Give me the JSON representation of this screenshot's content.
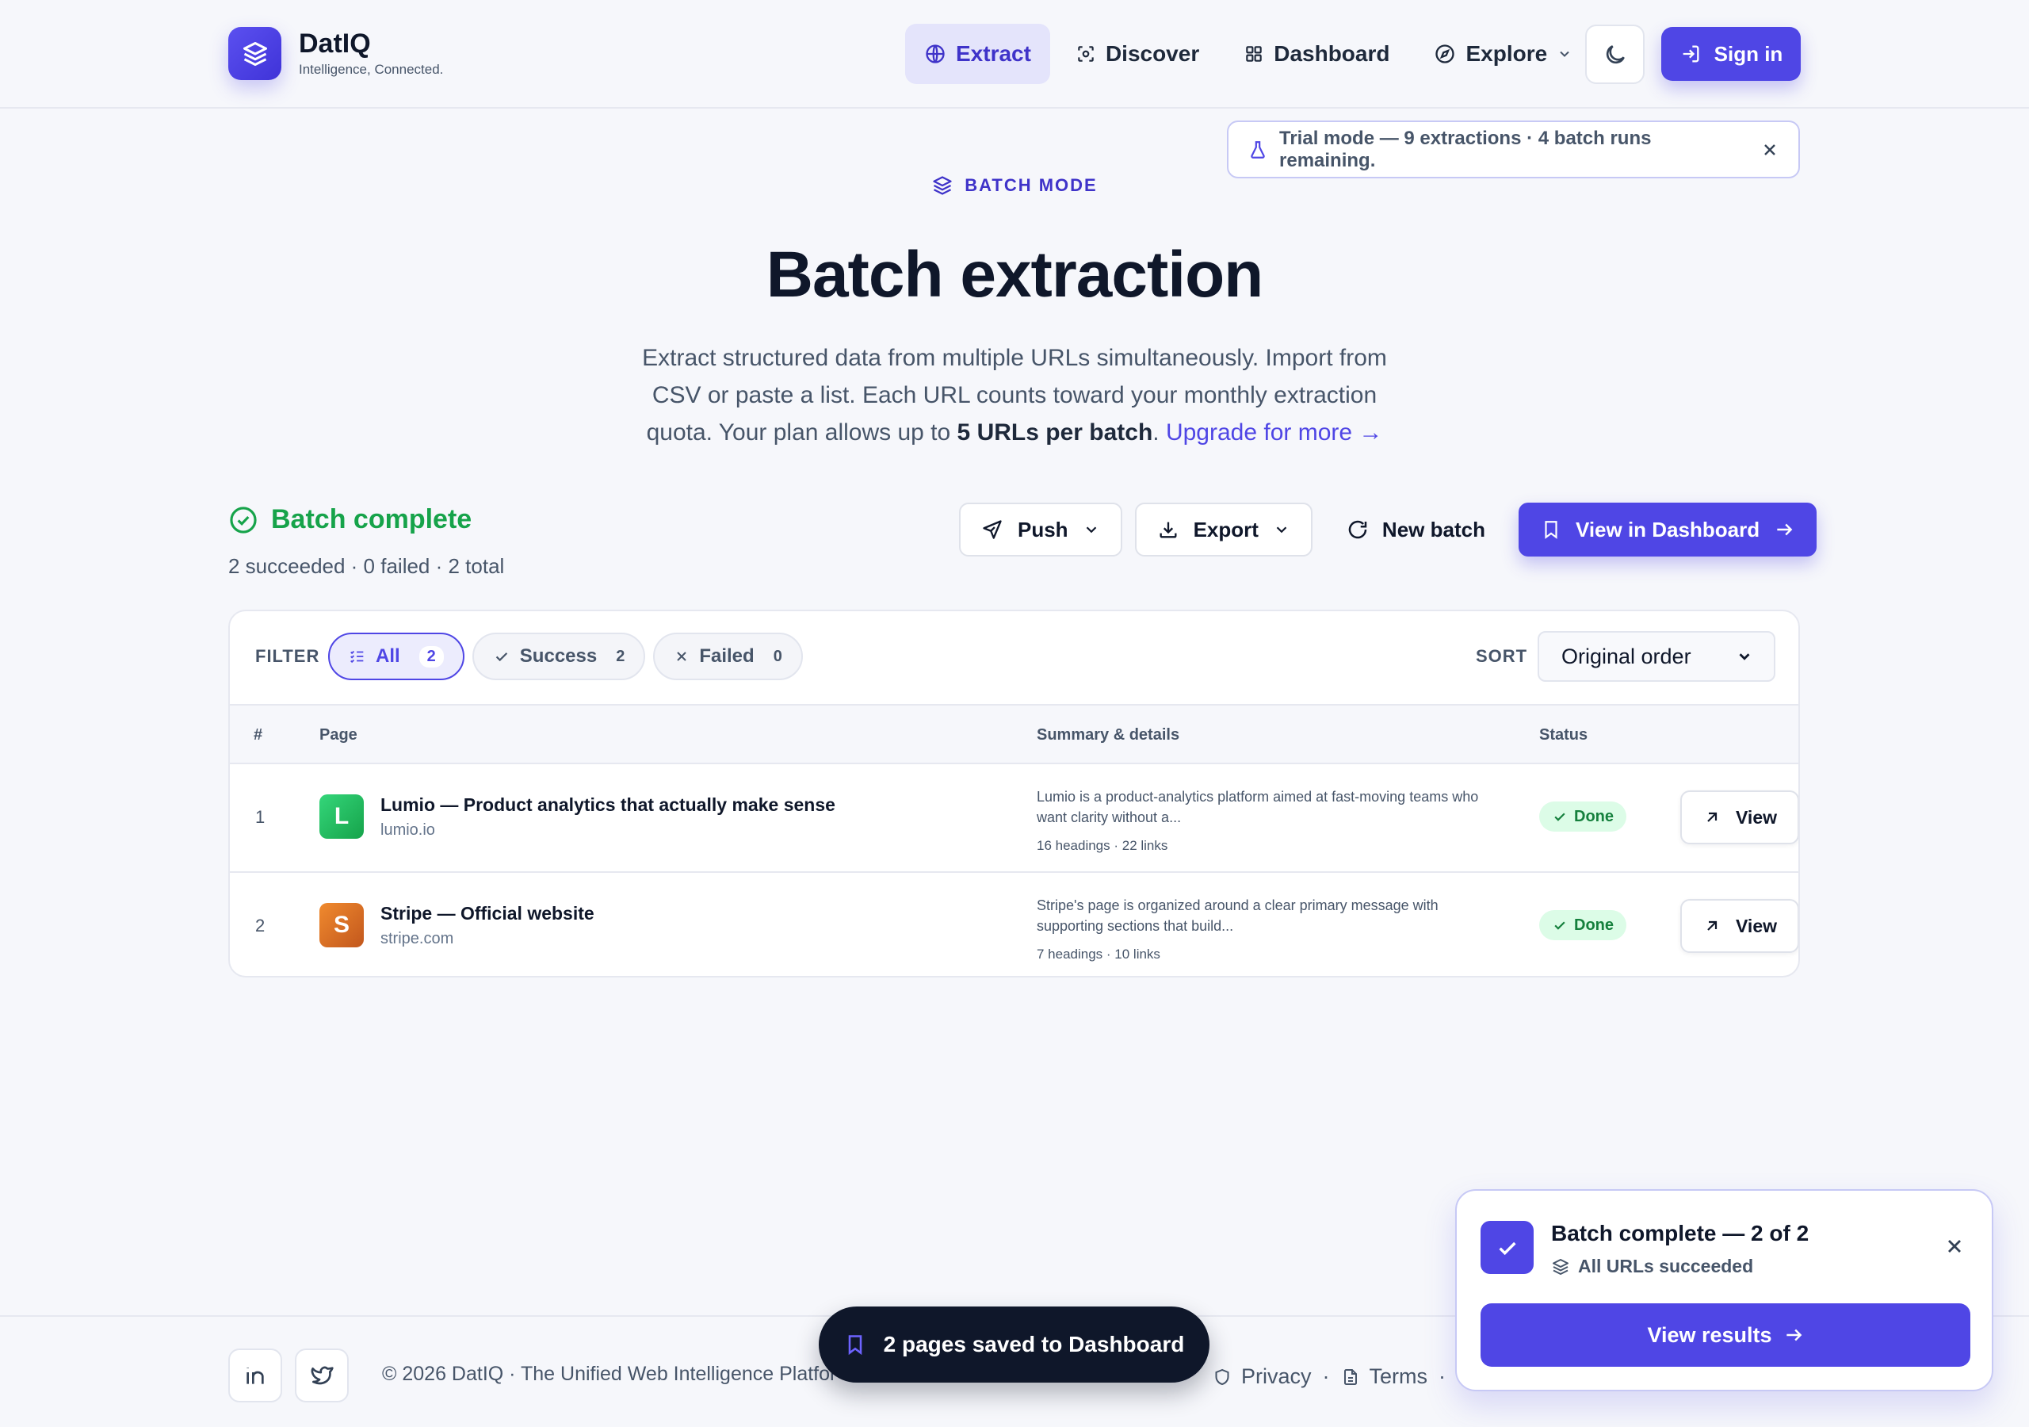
{
  "header": {
    "brand_name": "DatIQ",
    "brand_tagline": "Intelligence, Connected.",
    "nav": [
      {
        "label": "Extract",
        "icon": "globe-icon",
        "active": true
      },
      {
        "label": "Discover",
        "icon": "scan-icon"
      },
      {
        "label": "Dashboard",
        "icon": "grid-icon"
      },
      {
        "label": "Explore",
        "icon": "compass-icon"
      }
    ],
    "theme_icon": "moon-icon",
    "signin_label": "Sign in"
  },
  "trial_banner": {
    "text": "Trial mode — 9 extractions · 4 batch runs remaining."
  },
  "hero": {
    "eyebrow": "BATCH MODE",
    "title": "Batch extraction",
    "desc_part1": "Extract structured data from multiple URLs simultaneously. Import from CSV or paste a list. Each URL counts toward your monthly extraction quota. Your plan allows up to ",
    "desc_bold": "5 URLs per batch",
    "desc_part2": ". ",
    "desc_link": "Upgrade for more →"
  },
  "batch": {
    "status_title": "Batch complete",
    "status_sub": "2 succeeded · 0 failed · 2 total",
    "actions": {
      "push": "Push",
      "export": "Export",
      "new_batch": "New batch",
      "view_dashboard": "View in Dashboard"
    }
  },
  "filter": {
    "label": "FILTER",
    "chips": [
      {
        "label": "All",
        "count": "2",
        "active": true
      },
      {
        "label": "Success",
        "count": "2"
      },
      {
        "label": "Failed",
        "count": "0"
      }
    ],
    "sort_label": "SORT",
    "sort_value": "Original order"
  },
  "table": {
    "columns": [
      "#",
      "Page",
      "Summary & details",
      "Status"
    ],
    "rows": [
      {
        "num": "1",
        "favicon_letter": "L",
        "favicon_color": "#22c55e",
        "title": "Lumio — Product analytics that actually make sense",
        "domain": "lumio.io",
        "summary": "Lumio is a product-analytics platform aimed at fast-moving teams who want clarity without a...",
        "meta": "16 headings · 22 links",
        "status": "Done",
        "action": "View"
      },
      {
        "num": "2",
        "favicon_letter": "S",
        "favicon_color": "#e0722c",
        "title": "Stripe — Official website",
        "domain": "stripe.com",
        "summary": "Stripe's page is organized around a clear primary message with supporting sections that build...",
        "meta": "7 headings · 10 links",
        "status": "Done",
        "action": "View"
      }
    ]
  },
  "footer": {
    "copyright": "© 2026 DatIQ · The Unified Web Intelligence Platfor",
    "links": [
      "Privacy",
      "Terms"
    ],
    "separator": "·"
  },
  "saved_toast": {
    "text": "2 pages saved to Dashboard"
  },
  "notification": {
    "title": "Batch complete — 2 of 2",
    "subtitle": "All URLs succeeded",
    "button": "View results"
  },
  "colors": {
    "accent": "#4f46e5",
    "success": "#16a34a",
    "text": "#0f172a",
    "muted": "#475569"
  }
}
